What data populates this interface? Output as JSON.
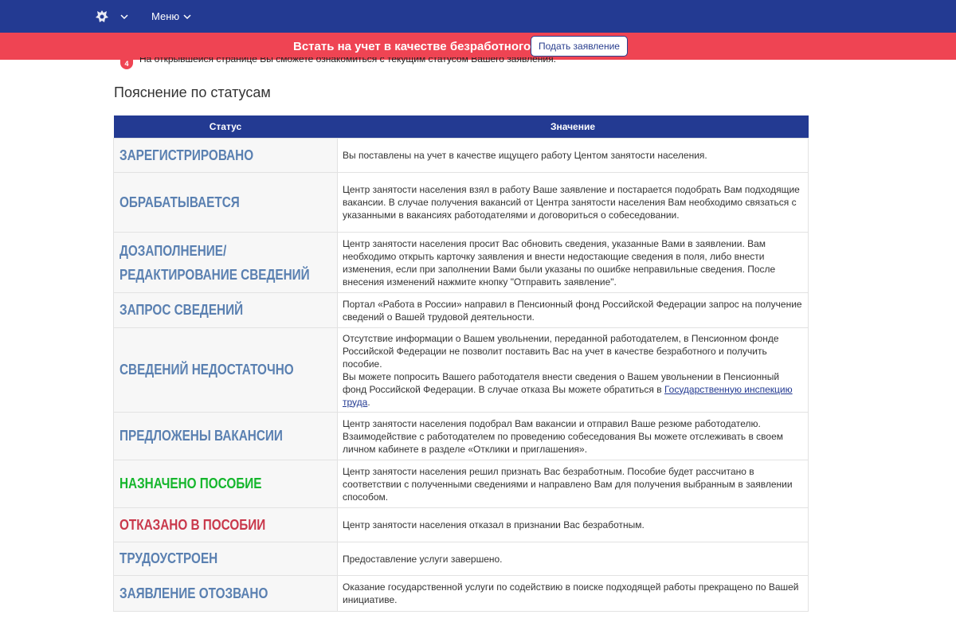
{
  "header": {
    "emblem_icon": "coat-of-arms-icon",
    "menu_label": "Меню"
  },
  "banner": {
    "text": "Встать на учет в качестве безработного",
    "button_label": "Подать заявление"
  },
  "steps": [
    {
      "number": "4",
      "text": "На открывшейся странице Вы сможете ознакомиться с текущим статусом Вашего заявления."
    }
  ],
  "section_title": "Пояснение по статусам",
  "table": {
    "headers": [
      "Статус",
      "Значение"
    ],
    "rows": [
      {
        "status": "Зарегистрировано",
        "desc": "Вы поставлены на учет в качестве ищущего работу Центом занятости населения."
      },
      {
        "status": "Обрабатывается",
        "desc": "Центр занятости населения взял в работу Ваше заявление и постарается подобрать Вам подходящие вакансии. В случае получения вакансий от Центра занятости населения Вам необходимо связаться с указанными в вакансиях работодателями и договориться о собеседовании."
      },
      {
        "status": "Дозаполнение/редактирование сведений",
        "desc": "Центр занятости населения просит Вас обновить сведения, указанные Вами в заявлении. Вам необходимо открыть карточку заявления и внести недостающие сведения в поля, либо внести изменения, если при заполнении Вами были указаны по ошибке неправильные сведения. После внесения изменений нажмите кнопку \"Отправить заявление\"."
      },
      {
        "status": "Запрос сведений",
        "desc": "Портал «Работа в России» направил в Пенсионный фонд Российской Федерации запрос на получение сведений о Вашей трудовой деятельности."
      },
      {
        "status": "Сведений недостаточно",
        "desc": "Отсутствие информации о Вашем увольнении, переданной работодателем, в Пенсионном фонде Российской Федерации не позволит поставить Вас на учет в качестве безработного и получить пособие.",
        "desc2": "Вы можете попросить Вашего работодателя внести сведения о Вашем увольнении в Пенсионный фонд Российской Федерации. В случае отказа Вы можете обратиться в ",
        "link": "Государственную инспекцию труда",
        "desc3": "."
      },
      {
        "status": "Предложены вакансии",
        "desc": "Центр занятости населения подобрал Вам вакансии и отправил Ваше резюме работодателю. Взаимодействие с работодателем по проведению собеседования Вы можете отслеживать в своем личном кабинете в разделе «Отклики и приглашения»."
      },
      {
        "status": "Назначено пособие",
        "desc": "Центр занятости населения решил признать Вас безработным. Пособие будет рассчитано в соответствии с полученными сведениями и направлено Вам для получения выбранным в заявлении способом."
      },
      {
        "status": "Отказано в пособии",
        "desc": "Центр занятости населения отказал в признании Вас безработным."
      },
      {
        "status": "Трудоустроен",
        "desc": "Предоставление услуги завершено."
      },
      {
        "status": "Заявление отозвано",
        "desc": "Оказание государственной услуги по содействию в поиске подходящей работы прекращено по Вашей инициативе."
      }
    ]
  },
  "colors": {
    "header_bg": "#233a92",
    "banner_bg": "#ef4453",
    "status_default": "#5a80b1",
    "status_positive": "#15b62c",
    "status_negative": "#c9384b"
  }
}
